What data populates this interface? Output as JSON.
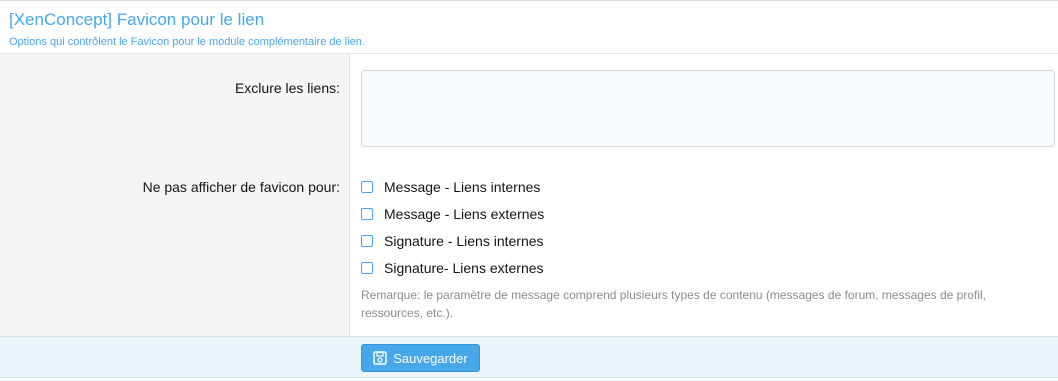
{
  "header": {
    "title": "[XenConcept] Favicon pour le lien",
    "subtitle": "Options qui contrôlent le Favicon pour le module complémentaire de lien."
  },
  "form": {
    "exclude_links": {
      "label": "Exclure les liens:",
      "value": ""
    },
    "no_favicon": {
      "label": "Ne pas afficher de favicon pour:",
      "options": [
        {
          "label": "Message - Liens internes",
          "checked": false
        },
        {
          "label": "Message - Liens externes",
          "checked": false
        },
        {
          "label": "Signature - Liens internes",
          "checked": false
        },
        {
          "label": "Signature- Liens externes",
          "checked": false
        }
      ],
      "remark": "Remarque: le paramètre de message comprend plusieurs types de contenu (messages de forum, messages de profil, ressources, etc.)."
    }
  },
  "footer": {
    "save_label": "Sauvegarder",
    "save_icon": "save-icon"
  },
  "colors": {
    "accent": "#47a7eb",
    "label_bg": "#f5f5f5",
    "footer_bg": "#edf5fc",
    "input_bg": "#f7fbfe",
    "remark": "#8c8c8c"
  }
}
